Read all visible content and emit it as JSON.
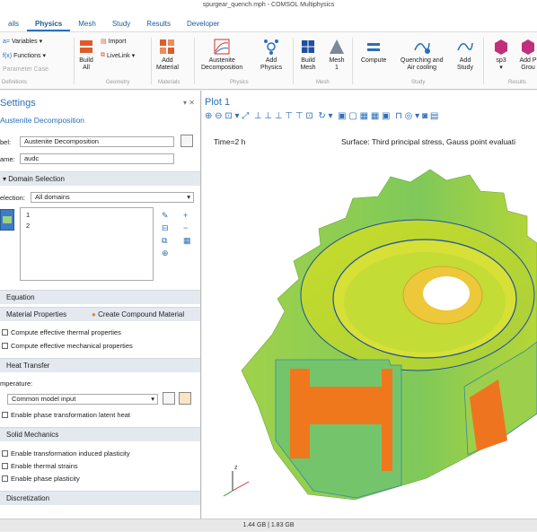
{
  "window": {
    "title": "spurgear_quench.mph - COMSOL Multiphysics"
  },
  "tabs": [
    "ails",
    "Physics",
    "Mesh",
    "Study",
    "Results",
    "Developer"
  ],
  "ribbon": {
    "variables": "Variables",
    "functions": "Functions",
    "parameter_case": "Parameter Case",
    "definitions_group": "Definitions",
    "build_all": [
      "Build",
      "All"
    ],
    "import": "Import",
    "livelink": "LiveLink",
    "geometry_group": "Geometry",
    "add_material": [
      "Add",
      "Material"
    ],
    "materials_group": "Materials",
    "austenite": [
      "Austenite",
      "Decomposition"
    ],
    "add_physics": [
      "Add",
      "Physics"
    ],
    "physics_group": "Physics",
    "build_mesh": [
      "Build",
      "Mesh"
    ],
    "mesh1": [
      "Mesh",
      "1"
    ],
    "mesh_group": "Mesh",
    "compute": "Compute",
    "quenching": [
      "Quenching and",
      "Air cooling"
    ],
    "add_study": [
      "Add",
      "Study"
    ],
    "study_group": "Study",
    "sp3": "sp3",
    "add_plot_group": [
      "Add P",
      "Grou"
    ],
    "results_group": "Results"
  },
  "settings": {
    "header": "Settings",
    "subtitle": "Austenite Decomposition",
    "label_caption": "bel:",
    "label_value": "Austenite Decomposition",
    "name_caption": "ame:",
    "name_value": "audc",
    "domain_section": "Domain Selection",
    "selection_caption": "election:",
    "selection_value": "All domains",
    "domain_items": [
      "1",
      "2"
    ],
    "equation_section": "Equation",
    "material_properties": "Material Properties",
    "create_compound": "Create Compound Material",
    "thermal_props": "Compute effective thermal properties",
    "mechanical_props": "Compute effective mechanical properties",
    "heat_transfer_section": "Heat Transfer",
    "temperature_caption": "mperature:",
    "temperature_value": "Common model input",
    "latent_heat": "Enable phase transformation latent heat",
    "solid_mechanics_section": "Solid Mechanics",
    "trip": "Enable transformation induced plasticity",
    "thermal_strains": "Enable thermal strains",
    "phase_plasticity": "Enable phase plasticity",
    "discretization_section": "Discretization"
  },
  "graphics": {
    "tab": "Plot 1",
    "time_label": "Time=2 h",
    "surface_label": "Surface: Third principal stress, Gauss point evaluati"
  },
  "status": {
    "memory": "1.44 GB | 1.83 GB"
  },
  "colors": {
    "accent": "#2a6ebb",
    "panel_header": "#e4e9ef",
    "mesh_blue": "#1f4fa0"
  }
}
